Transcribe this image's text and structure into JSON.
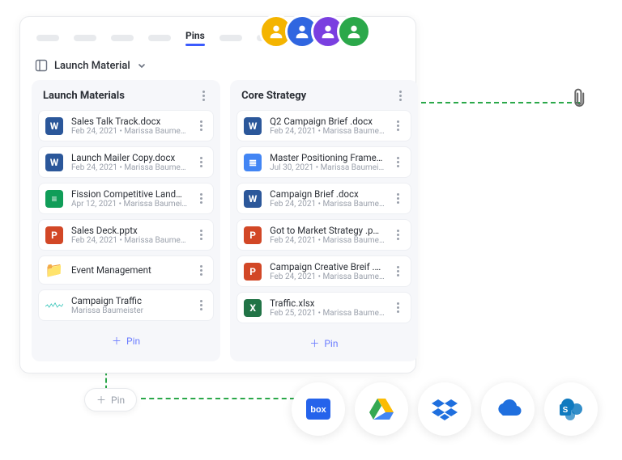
{
  "tabs": {
    "active_label": "Pins"
  },
  "selector": {
    "label": "Launch Material"
  },
  "columns": [
    {
      "title": "Launch Materials",
      "items": [
        {
          "icon": "word",
          "glyph": "W",
          "title": "Sales Talk Track.docx",
          "meta": "Feb 24, 2021 • Marissa Baume…"
        },
        {
          "icon": "word",
          "glyph": "W",
          "title": "Launch Mailer Copy.docx",
          "meta": "Feb 24, 2021 • Marissa Baume…"
        },
        {
          "icon": "sheets",
          "glyph": "≡",
          "title": "Fission Competitive Land…",
          "meta": "Apr 12, 2021 • Marissa Baumei…"
        },
        {
          "icon": "ppt",
          "glyph": "P",
          "title": "Sales Deck.pptx",
          "meta": "Feb 24, 2021 • Marissa Baume…"
        },
        {
          "icon": "folder",
          "glyph": "📁",
          "title": "Event Management",
          "meta": ""
        },
        {
          "icon": "spark",
          "glyph": "",
          "title": "Campaign Traffic",
          "meta": "Marissa Baumeister"
        }
      ],
      "pin_label": "Pin"
    },
    {
      "title": "Core Strategy",
      "items": [
        {
          "icon": "word",
          "glyph": "W",
          "title": "Q2 Campaign Brief .docx",
          "meta": "Feb 24, 2021 • Marissa Baume…"
        },
        {
          "icon": "gdoc",
          "glyph": "≣",
          "title": "Master Positioning Frame…",
          "meta": "Jul 30, 2021 • Marissa Baumei…"
        },
        {
          "icon": "word",
          "glyph": "W",
          "title": "Campaign Brief .docx",
          "meta": "Feb 24, 2021 • Marissa Baume…"
        },
        {
          "icon": "ppt",
          "glyph": "P",
          "title": "Got to Market Strategy .p…",
          "meta": "Feb 24, 2021 • Marissa Baume…"
        },
        {
          "icon": "ppt",
          "glyph": "P",
          "title": "Campaign Creative Breif .…",
          "meta": "Feb 24, 2021 • Marissa Baume…"
        },
        {
          "icon": "excel",
          "glyph": "X",
          "title": "Traffic.xlsx",
          "meta": "Feb 25, 2021 • Marissa Baume…"
        }
      ],
      "pin_label": "Pin"
    }
  ],
  "avatars": [
    {
      "bg": "#f4b400"
    },
    {
      "bg": "#3066e0"
    },
    {
      "bg": "#7a3fe0"
    },
    {
      "bg": "#2ba84a"
    }
  ],
  "float_pin_label": "Pin",
  "integrations": [
    {
      "name": "box",
      "color": "#2563eb"
    },
    {
      "name": "gdrive",
      "color": "#34a853"
    },
    {
      "name": "dropbox",
      "color": "#1f6fde"
    },
    {
      "name": "onedrive",
      "color": "#1f6fde"
    },
    {
      "name": "sharepoint",
      "color": "#0f7abf"
    }
  ]
}
